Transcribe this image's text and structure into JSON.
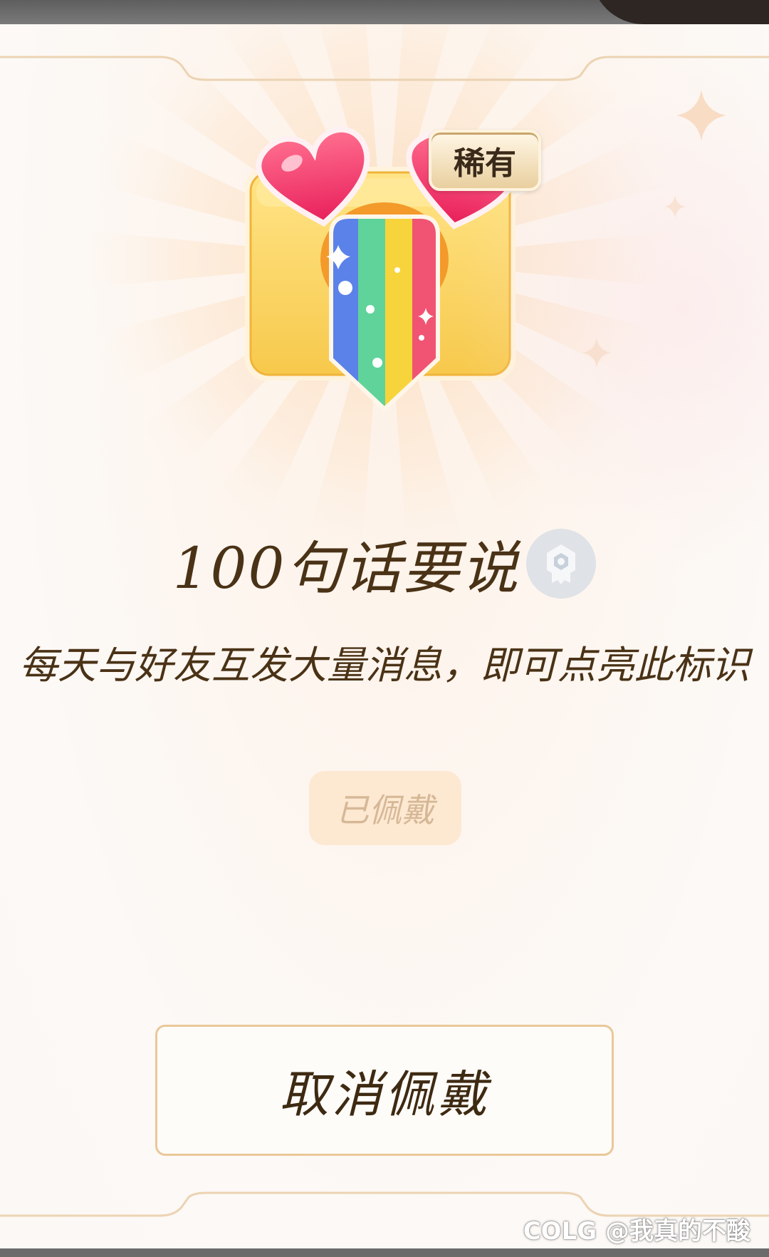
{
  "rarity_tag": "稀有",
  "badge": {
    "title": "100句话要说",
    "description": "每天与好友互发大量消息，即可点亮此标识",
    "status": "已佩戴"
  },
  "actions": {
    "cancel_label": "取消佩戴"
  },
  "watermark": "COLG @我真的不酸",
  "colors": {
    "accent_border": "#e9c898",
    "text_brown": "#4a3216",
    "status_bg": "#fde8d2"
  },
  "icons": {
    "badge_art": "rainbow-tongue-hearts-badge",
    "medal": "medal-icon",
    "sparkle": "sparkle-icon"
  }
}
